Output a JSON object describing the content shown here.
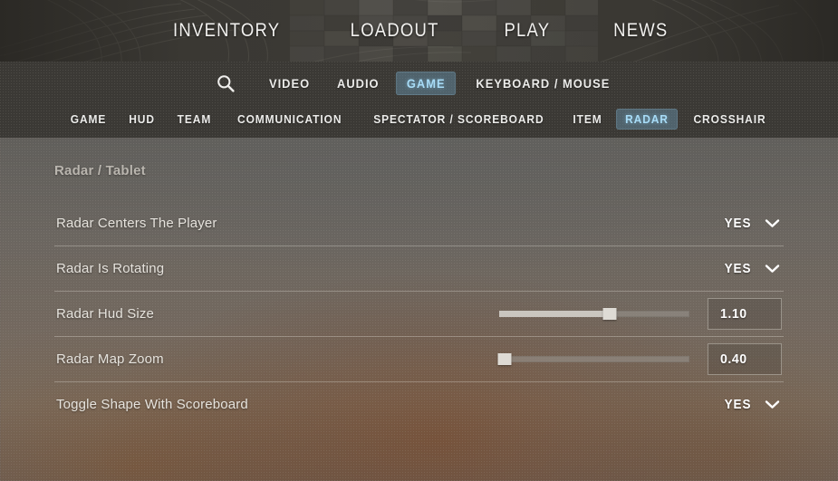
{
  "top_nav": {
    "items": [
      {
        "label": "INVENTORY",
        "name": "inventory"
      },
      {
        "label": "LOADOUT",
        "name": "loadout"
      },
      {
        "label": "PLAY",
        "name": "play"
      },
      {
        "label": "NEWS",
        "name": "news"
      }
    ]
  },
  "settings_tabs": {
    "search_icon": "search-icon",
    "items": [
      {
        "label": "VIDEO",
        "name": "video",
        "active": false
      },
      {
        "label": "AUDIO",
        "name": "audio",
        "active": false
      },
      {
        "label": "GAME",
        "name": "game",
        "active": true
      },
      {
        "label": "KEYBOARD / MOUSE",
        "name": "keyboard-mouse",
        "active": false
      }
    ]
  },
  "sub_tabs": {
    "items": [
      {
        "label": "GAME",
        "name": "game",
        "active": false
      },
      {
        "label": "HUD",
        "name": "hud",
        "active": false
      },
      {
        "label": "TEAM",
        "name": "team",
        "active": false
      },
      {
        "label": "COMMUNICATION",
        "name": "communication",
        "active": false
      },
      {
        "label": "SPECTATOR / SCOREBOARD",
        "name": "spectator-scoreboard",
        "active": false
      },
      {
        "label": "ITEM",
        "name": "item",
        "active": false
      },
      {
        "label": "RADAR",
        "name": "radar",
        "active": true
      },
      {
        "label": "CROSSHAIR",
        "name": "crosshair",
        "active": false
      }
    ]
  },
  "panel": {
    "section_title": "Radar / Tablet",
    "rows": [
      {
        "name": "radar-centers-the-player",
        "label": "Radar Centers The Player",
        "control": "dropdown",
        "value": "YES"
      },
      {
        "name": "radar-is-rotating",
        "label": "Radar Is Rotating",
        "control": "dropdown",
        "value": "YES"
      },
      {
        "name": "radar-hud-size",
        "label": "Radar Hud Size",
        "control": "slider",
        "value": "1.10",
        "percent": 58
      },
      {
        "name": "radar-map-zoom",
        "label": "Radar Map Zoom",
        "control": "slider",
        "value": "0.40",
        "percent": 3
      },
      {
        "name": "toggle-shape-with-scoreboard",
        "label": "Toggle Shape With Scoreboard",
        "control": "dropdown",
        "value": "YES"
      }
    ]
  },
  "colors": {
    "accent_blue": "#a8dcf7",
    "accent_blue_bg": "rgba(106,150,178,0.45)",
    "text_primary": "#ffffff",
    "text_label": "#e6e3dd",
    "section_title": "#b9b5ae",
    "banner_bg": "#3c3a35"
  }
}
